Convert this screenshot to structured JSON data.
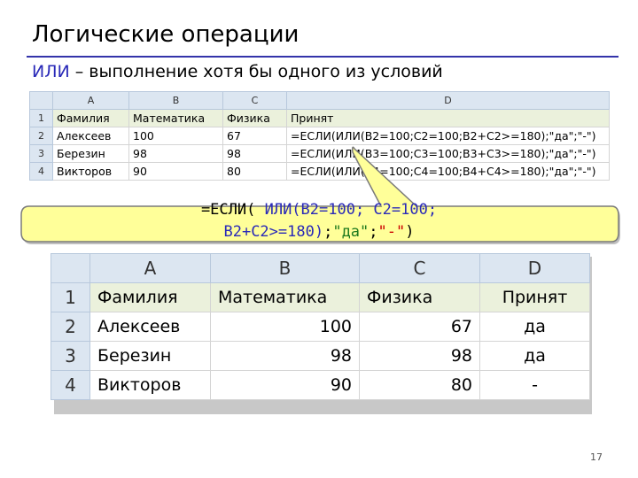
{
  "slide": {
    "title": "Логические операции",
    "subtitle_keyword": "ИЛИ",
    "subtitle_rest": " – выполнение хотя бы одного из условий",
    "page_number": "17"
  },
  "top_table": {
    "col_headers": [
      "A",
      "B",
      "C",
      "D"
    ],
    "row_headers": [
      "1",
      "2",
      "3",
      "4"
    ],
    "rows": [
      [
        "Фамилия",
        "Математика",
        "Физика",
        "Принят"
      ],
      [
        "Алексеев",
        "100",
        "67",
        "=ЕСЛИ(ИЛИ(B2=100;C2=100;B2+C2>=180);\"да\";\"-\")"
      ],
      [
        "Березин",
        "98",
        "98",
        "=ЕСЛИ(ИЛИ(B3=100;C3=100;B3+C3>=180);\"да\";\"-\")"
      ],
      [
        "Викторов",
        "90",
        "80",
        "=ЕСЛИ(ИЛИ(B4=100;C4=100;B4+C4>=180);\"да\";\"-\")"
      ]
    ]
  },
  "callout": {
    "p1": "=ЕСЛИ( ",
    "p2": "ИЛИ(B2=100; C2=100;",
    "p3": "B2+C2>=180)",
    "p4": ";",
    "p5": "\"да\"",
    "p6": ";",
    "p7": "\"-\"",
    "p8": ")"
  },
  "bottom_table": {
    "col_headers": [
      "A",
      "B",
      "C",
      "D"
    ],
    "row_headers": [
      "1",
      "2",
      "3",
      "4"
    ],
    "rows": [
      [
        "Фамилия",
        "Математика",
        "Физика",
        "Принят"
      ],
      [
        "Алексеев",
        "100",
        "67",
        "да"
      ],
      [
        "Березин",
        "98",
        "98",
        "да"
      ],
      [
        "Викторов",
        "90",
        "80",
        "-"
      ]
    ]
  }
}
